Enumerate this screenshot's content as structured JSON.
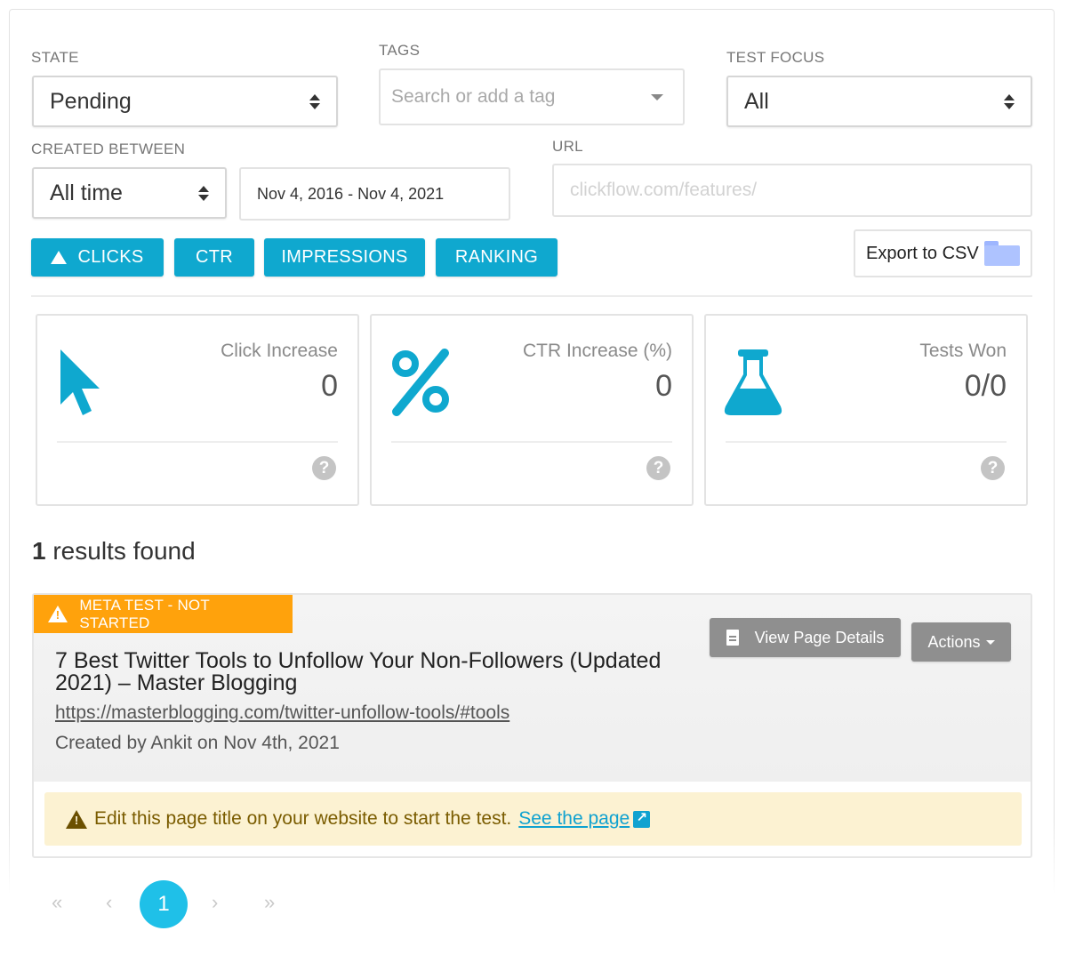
{
  "filters": {
    "state": {
      "label": "STATE",
      "value": "Pending"
    },
    "tags": {
      "label": "TAGS",
      "placeholder": "Search or add a tag"
    },
    "test_focus": {
      "label": "TEST FOCUS",
      "value": "All"
    },
    "created_between": {
      "label": "CREATED BETWEEN",
      "value": "All time",
      "date_range": "Nov 4, 2016 - Nov 4, 2021"
    },
    "url": {
      "label": "URL",
      "placeholder": "clickflow.com/features/"
    }
  },
  "metric_buttons": [
    {
      "label": "CLICKS",
      "active": true
    },
    {
      "label": "CTR"
    },
    {
      "label": "IMPRESSIONS"
    },
    {
      "label": "RANKING"
    }
  ],
  "export": {
    "label": "Export to CSV",
    "icon": "folder-icon"
  },
  "cards": [
    {
      "title": "Click Increase",
      "value": "0",
      "icon": "cursor-icon"
    },
    {
      "title": "CTR Increase (%)",
      "value": "0",
      "icon": "percent-icon"
    },
    {
      "title": "Tests Won",
      "value": "0/0",
      "icon": "flask-icon"
    }
  ],
  "help_symbol": "?",
  "results": {
    "count": "1",
    "text": "results found"
  },
  "result": {
    "badge": "META TEST - NOT STARTED",
    "title": "7 Best Twitter Tools to Unfollow Your Non-Followers (Updated 2021) – Master Blogging",
    "url": "https://masterblogging.com/twitter-unfollow-tools/#tools",
    "created": "Created by Ankit on Nov 4th, 2021",
    "view_button": "View Page Details",
    "actions_button": "Actions",
    "alert_text": "Edit this page title on your website to start the test.",
    "alert_link": "See the page"
  },
  "pagination": {
    "first": "«",
    "prev": "‹",
    "current": "1",
    "next": "›",
    "last": "»"
  },
  "colors": {
    "accent": "#0fa8cf",
    "badge": "#ffa20c",
    "alert_bg": "#fcf2d2",
    "page_active": "#1fc0e8"
  }
}
